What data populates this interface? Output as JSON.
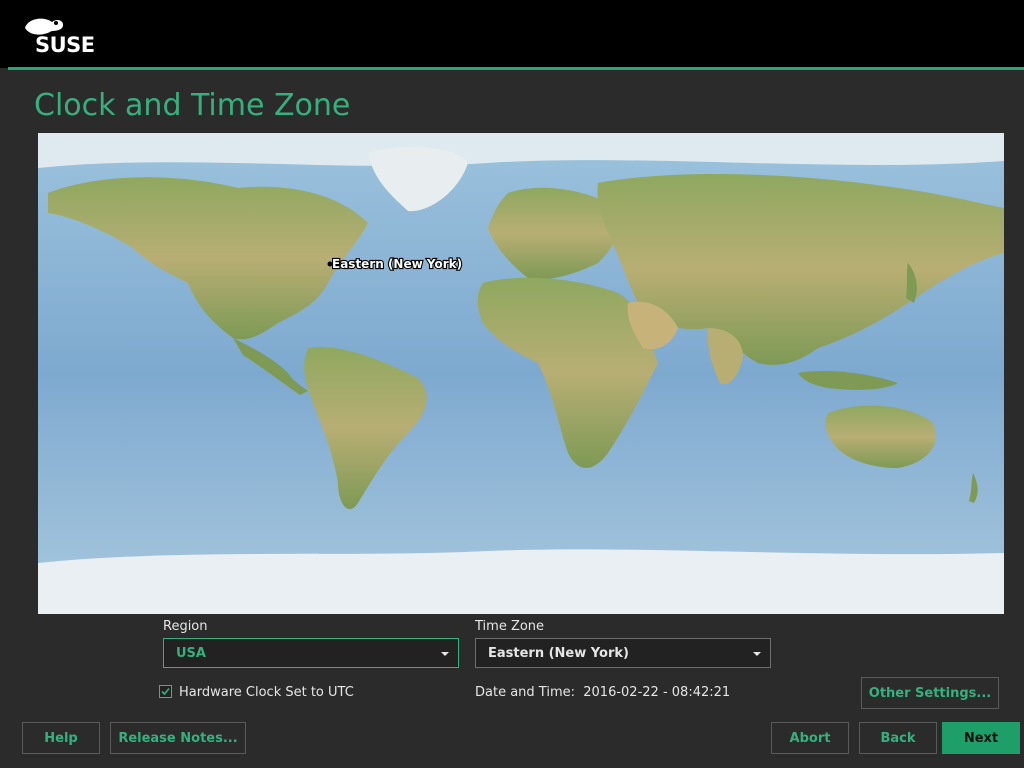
{
  "brand": {
    "name": "SUSE"
  },
  "page": {
    "title": "Clock and Time Zone"
  },
  "map": {
    "selected_zone_label": "Eastern (New York)"
  },
  "region": {
    "label": "Region",
    "value": "USA"
  },
  "timezone": {
    "label": "Time Zone",
    "value": "Eastern (New York)"
  },
  "hardware_clock": {
    "label": "Hardware Clock Set to UTC",
    "checked": true
  },
  "datetime": {
    "label": "Date and Time:",
    "value": "2016-02-22 - 08:42:21"
  },
  "buttons": {
    "other_settings": "Other Settings...",
    "help": "Help",
    "release_notes": "Release Notes...",
    "abort": "Abort",
    "back": "Back",
    "next": "Next"
  },
  "colors": {
    "accent": "#35b07e",
    "primary_button": "#1e9e68",
    "background": "#2b2b2b"
  }
}
